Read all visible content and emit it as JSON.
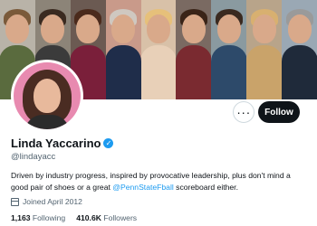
{
  "profile": {
    "name": "Linda Yaccarino",
    "handle": "@lindayacc",
    "verified": true,
    "bio_before": "Driven by industry progress, inspired by provocative leadership, plus don't mind a good pair of shoes or a great ",
    "bio_mention": "@PennStateFball",
    "bio_after": " scoreboard either.",
    "joined": "Joined April 2012",
    "following_count": "1,163",
    "following_label": "Following",
    "followers_count": "410.6K",
    "followers_label": "Followers"
  },
  "actions": {
    "more_label": "···",
    "follow_label": "Follow"
  },
  "colors": {
    "accent": "#1d9bf0",
    "text": "#0f1419",
    "muted": "#536471",
    "follow_bg": "#0f1419"
  },
  "icons": {
    "verified": "verified-badge-icon",
    "joined": "calendar-icon",
    "more": "more-icon"
  }
}
